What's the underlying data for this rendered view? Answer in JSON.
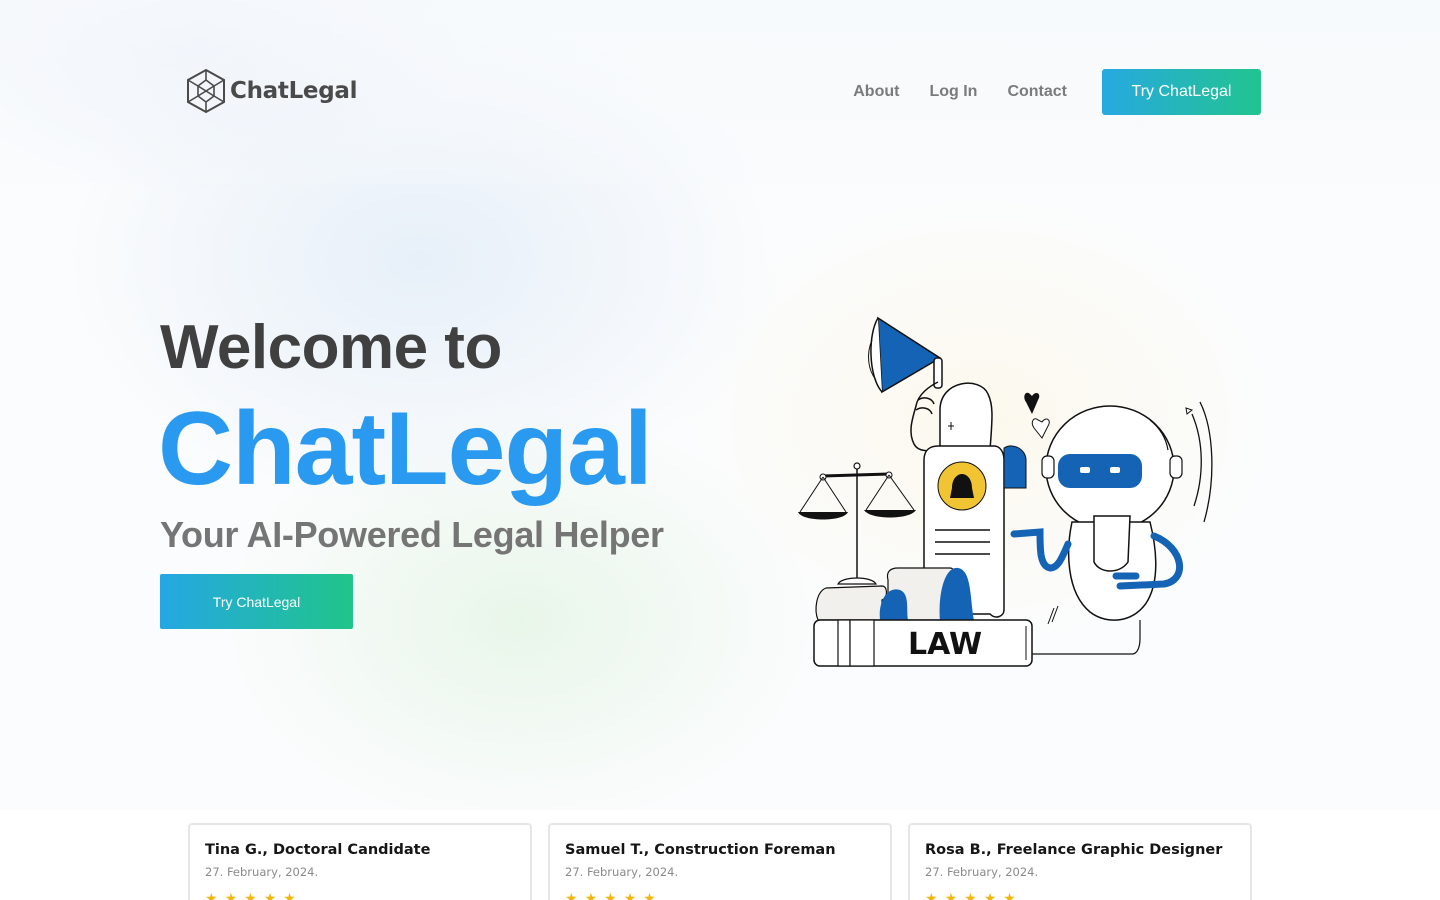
{
  "header": {
    "logo_text": "ChatLegal",
    "nav": {
      "about": "About",
      "login": "Log In",
      "contact": "Contact",
      "cta": "Try ChatLegal"
    }
  },
  "hero": {
    "welcome": "Welcome to",
    "brand": "ChatLegal",
    "tagline": "Your AI-Powered Legal Helper",
    "cta": "Try ChatLegal",
    "illustration_text": "LAW"
  },
  "reviews": [
    {
      "name": "Tina G., Doctoral Candidate",
      "date": "27. February, 2024.",
      "rating": 5
    },
    {
      "name": "Samuel T., Construction Foreman",
      "date": "27. February, 2024.",
      "rating": 5
    },
    {
      "name": "Rosa B., Freelance Graphic Designer",
      "date": "27. February, 2024.",
      "rating": 5
    }
  ],
  "colors": {
    "brand_blue": "#2a9af0",
    "gradient_start": "#27a9e1",
    "gradient_end": "#22c48f",
    "illustration_blue": "#1463b5",
    "star": "#f5b50a"
  },
  "icons": {
    "logo": "hexagon-logo-icon",
    "star": "star-icon"
  }
}
